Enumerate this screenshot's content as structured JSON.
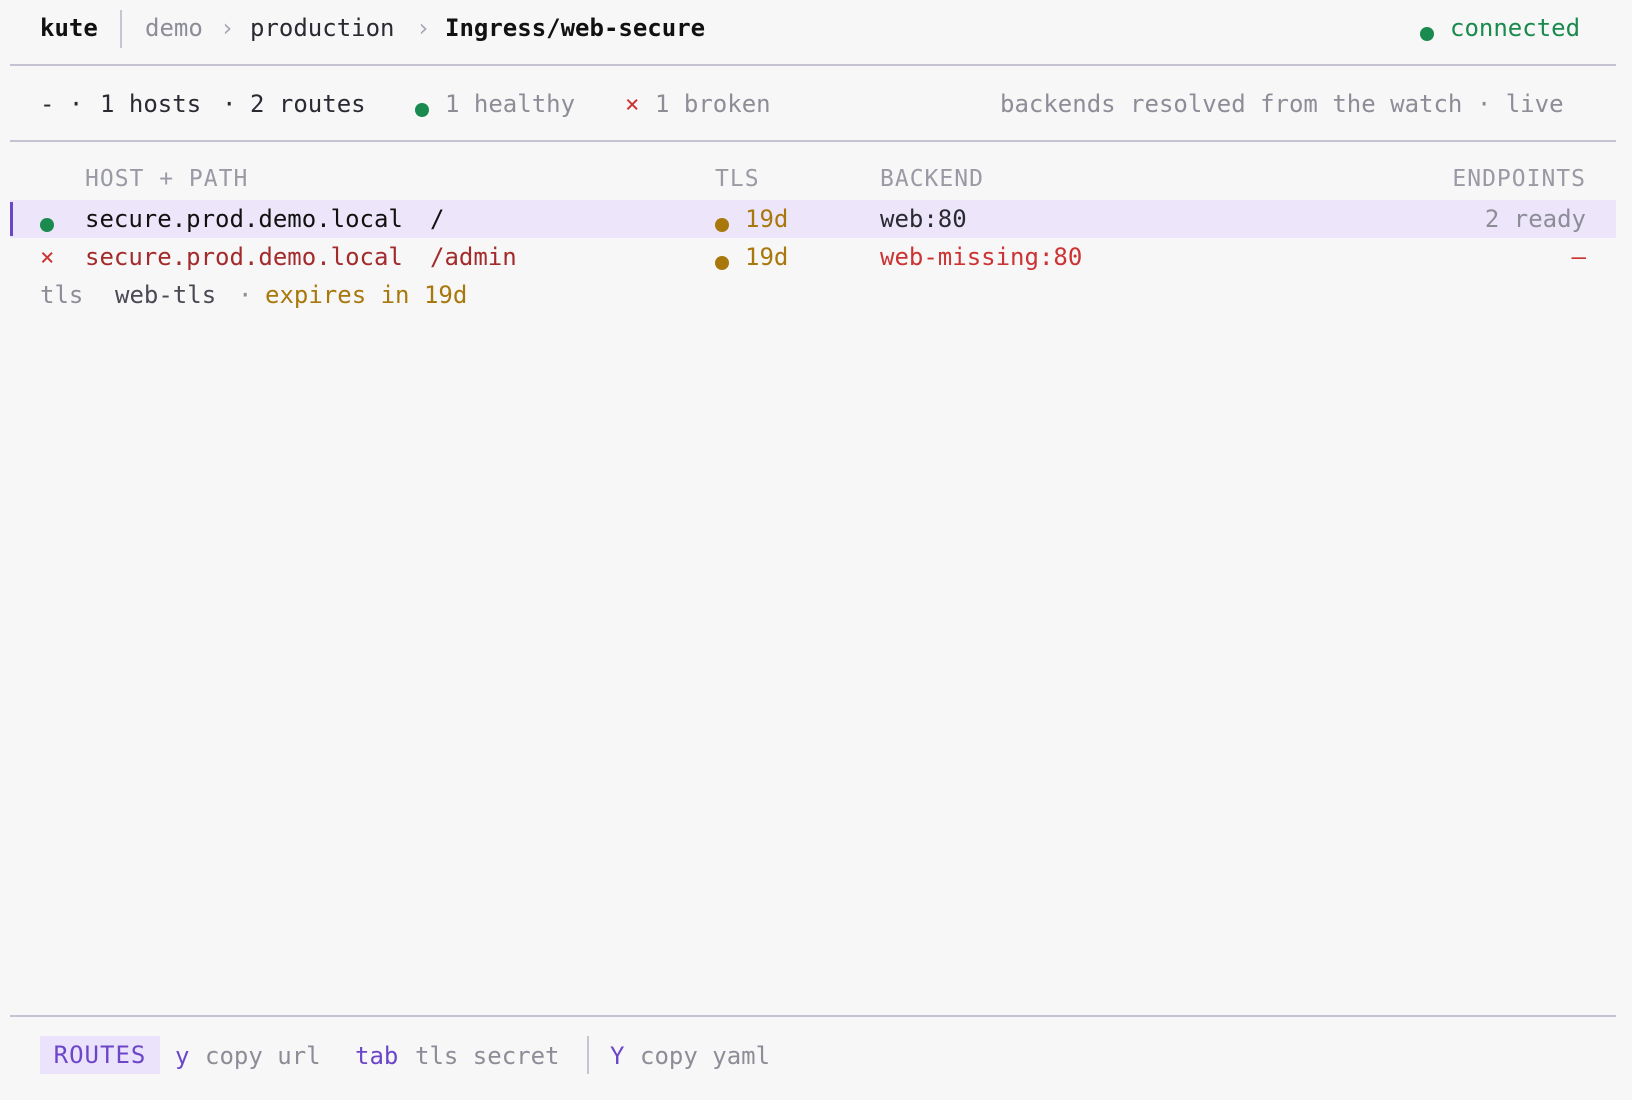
{
  "header": {
    "app_name": "kute",
    "breadcrumb": {
      "context": "demo",
      "sep1": "›",
      "namespace": "production",
      "sep2": "›",
      "resource": "Ingress/web-secure"
    },
    "connection_status": "connected"
  },
  "summary": {
    "prefix": "- ·",
    "hosts": "1 hosts",
    "dot1": "·",
    "routes": "2 routes",
    "healthy": "1 healthy",
    "broken_icon": "×",
    "broken": "1 broken",
    "note": "backends resolved from the watch · live"
  },
  "table": {
    "columns": {
      "host_path": "HOST + PATH",
      "tls": "TLS",
      "backend": "BACKEND",
      "endpoints": "ENDPOINTS"
    },
    "rows": [
      {
        "status": "healthy",
        "status_icon": "circle-dot",
        "host": "secure.prod.demo.local",
        "path": "/",
        "tls": "19d",
        "backend": "web:80",
        "endpoints": "2 ready"
      },
      {
        "status": "broken",
        "status_icon": "×",
        "host": "secure.prod.demo.local",
        "path": "/admin",
        "tls": "19d",
        "backend": "web-missing:80",
        "endpoints": "—"
      }
    ],
    "tls_detail": {
      "label": "tls",
      "secret": "web-tls",
      "sep": "·",
      "expiry": "expires in 19d"
    }
  },
  "footer": {
    "mode": "ROUTES",
    "hints": [
      {
        "key": "y",
        "desc": "copy url"
      },
      {
        "key": "tab",
        "desc": "tls secret"
      },
      {
        "key": "Y",
        "desc": "copy yaml"
      }
    ]
  },
  "colors": {
    "accent": "#6c46c9",
    "healthy": "#1a8a4e",
    "broken": "#cc3333",
    "warning": "#a8780c",
    "selected_row_bg": "#ede6fa"
  }
}
